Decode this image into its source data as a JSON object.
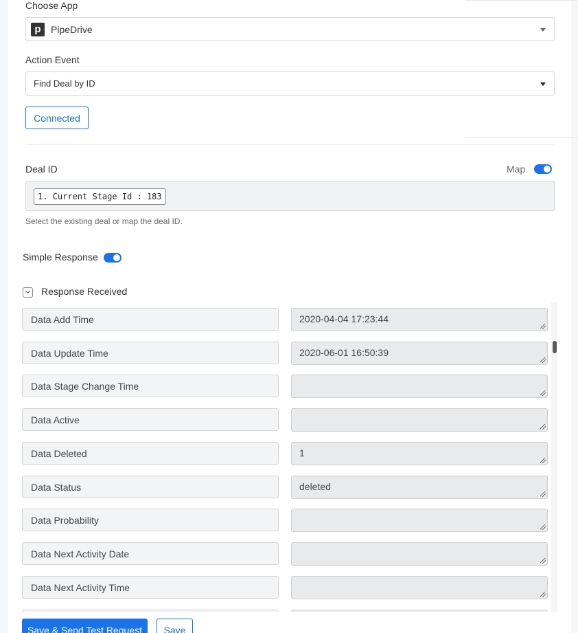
{
  "choose_app": {
    "label": "Choose App",
    "logo_letter": "p",
    "selected": "PipeDrive"
  },
  "action_event": {
    "label": "Action Event",
    "selected": "Find Deal by ID"
  },
  "connected_label": "Connected",
  "deal_id": {
    "label": "Deal ID",
    "map_label": "Map",
    "map_enabled": true,
    "chip": "1. Current Stage Id : 183",
    "hint": "Select the existing deal or map the deal ID."
  },
  "simple_response": {
    "label": "Simple Response",
    "enabled": true
  },
  "response": {
    "label": "Response Received",
    "rows": [
      {
        "key": "Data Add Time",
        "value": "2020-04-04 17:23:44"
      },
      {
        "key": "Data Update Time",
        "value": "2020-06-01 16:50:39"
      },
      {
        "key": "Data Stage Change Time",
        "value": ""
      },
      {
        "key": "Data Active",
        "value": ""
      },
      {
        "key": "Data Deleted",
        "value": "1"
      },
      {
        "key": "Data Status",
        "value": "deleted"
      },
      {
        "key": "Data Probability",
        "value": ""
      },
      {
        "key": "Data Next Activity Date",
        "value": ""
      },
      {
        "key": "Data Next Activity Time",
        "value": ""
      },
      {
        "key": "",
        "value": ""
      }
    ]
  },
  "buttons": {
    "save_send": "Save & Send Test Request",
    "save": "Save"
  },
  "colors": {
    "accent": "#1a73e8",
    "outline": "#1a73c8"
  }
}
